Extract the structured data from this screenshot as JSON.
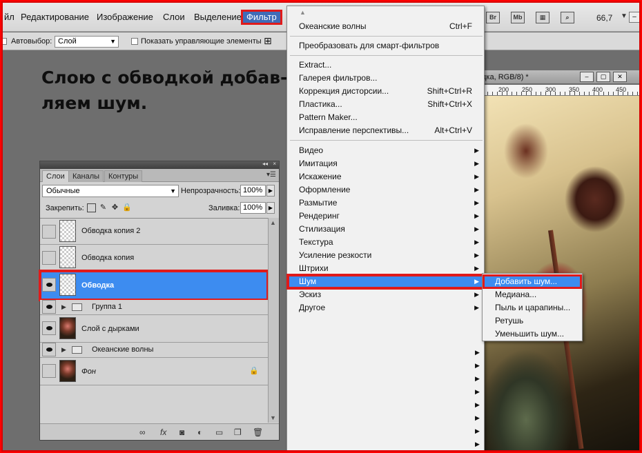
{
  "menubar": {
    "items": [
      "йл",
      "Редактирование",
      "Изображение",
      "Слои",
      "Выделение",
      "Фильтр"
    ],
    "icons": {
      "bridge": "Br",
      "minibridge": "Mb"
    },
    "zoom": "66,7"
  },
  "options": {
    "autoselect_label": "Автовыбор:",
    "autoselect_value": "Слой",
    "show_controls_label": "Показать управляющие элементы"
  },
  "heading": "Слою с обводкой добав-ляем шум.",
  "layers_panel": {
    "tabs": [
      "Слои",
      "Каналы",
      "Контуры"
    ],
    "blend_mode": "Обычные",
    "opacity_label": "Непрозрачность:",
    "opacity_value": "100%",
    "lock_label": "Закрепить:",
    "fill_label": "Заливка:",
    "fill_value": "100%",
    "layers": [
      {
        "name": "Обводка копия 2",
        "visible": false,
        "type": "layer",
        "thumb": "transparent"
      },
      {
        "name": "Обводка копия",
        "visible": false,
        "type": "layer",
        "thumb": "transparent"
      },
      {
        "name": "Обводка",
        "visible": true,
        "type": "layer",
        "thumb": "transparent",
        "selected": true
      },
      {
        "name": "Группа 1",
        "visible": true,
        "type": "group"
      },
      {
        "name": "Слой с дырками",
        "visible": true,
        "type": "layer",
        "thumb": "photo"
      },
      {
        "name": "Океанские волны",
        "visible": true,
        "type": "group"
      },
      {
        "name": "Фон",
        "visible": false,
        "type": "layer",
        "thumb": "photo",
        "locked": true
      }
    ]
  },
  "document": {
    "title": "дка, RGB/8) *",
    "ruler_ticks": [
      "200",
      "250",
      "300",
      "350",
      "400",
      "450"
    ]
  },
  "filter_menu": {
    "last_filter": {
      "label": "Океанские волны",
      "shortcut": "Ctrl+F"
    },
    "convert_smart": "Преобразовать для смарт-фильтров",
    "tools": [
      {
        "label": "Extract...",
        "shortcut": ""
      },
      {
        "label": "Галерея фильтров...",
        "shortcut": ""
      },
      {
        "label": "Коррекция дисторсии...",
        "shortcut": "Shift+Ctrl+R"
      },
      {
        "label": "Пластика...",
        "shortcut": "Shift+Ctrl+X"
      },
      {
        "label": "Pattern Maker...",
        "shortcut": ""
      },
      {
        "label": "Исправление перспективы...",
        "shortcut": "Alt+Ctrl+V"
      }
    ],
    "groups": [
      "Видео",
      "Имитация",
      "Искажение",
      "Оформление",
      "Размытие",
      "Рендеринг",
      "Стилизация",
      "Текстура",
      "Усиление резкости",
      "Штрихи",
      "Шум",
      "Эскиз",
      "Другое"
    ],
    "active_group": "Шум"
  },
  "noise_submenu": {
    "items": [
      "Добавить шум...",
      "Медиана...",
      "Пыль и царапины...",
      "Ретушь",
      "Уменьшить шум..."
    ],
    "active": "Добавить шум..."
  },
  "colors": {
    "highlight": "#e01a1a",
    "selection": "#3d8cf0"
  }
}
